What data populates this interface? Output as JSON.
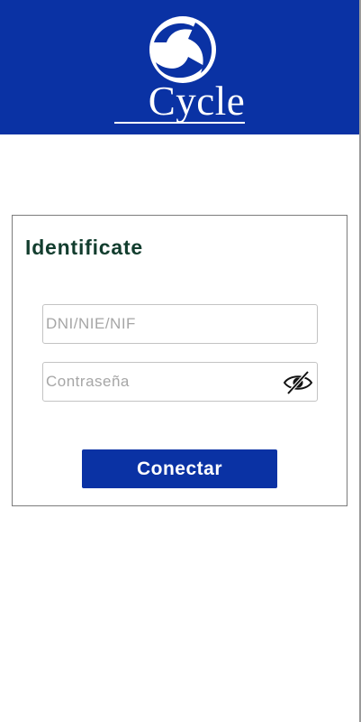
{
  "brand": {
    "logo_icon": "swirl-logo-icon",
    "name": "Cycle"
  },
  "login": {
    "title": "Identificate",
    "user_placeholder": "DNI/NIE/NIF",
    "user_value": "",
    "password_placeholder": "Contraseña",
    "password_value": "",
    "toggle_icon": "eye-slash-icon",
    "submit_label": "Conectar"
  },
  "colors": {
    "brand_blue": "#0a32a4",
    "title_green": "#123d2e",
    "white": "#ffffff"
  }
}
